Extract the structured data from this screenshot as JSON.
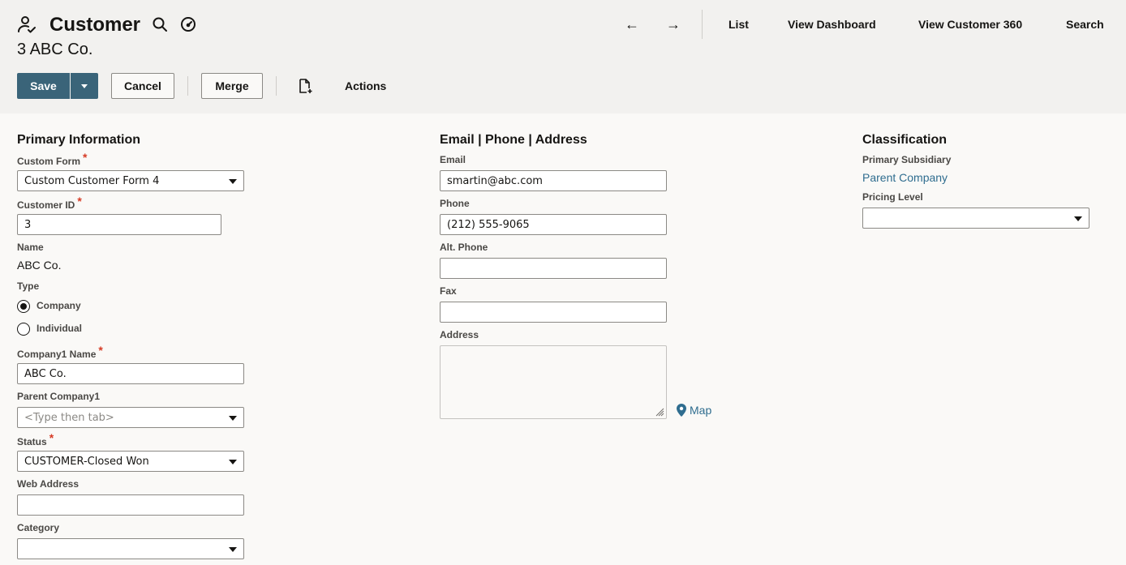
{
  "header": {
    "record_type": "Customer",
    "record_name": "3 ABC Co.",
    "nav": {
      "back_arrow": "←",
      "forward_arrow": "→",
      "list": "List",
      "view_dashboard": "View Dashboard",
      "view_customer_360": "View Customer 360",
      "search": "Search"
    },
    "icons": [
      "person-check-icon",
      "search-icon",
      "dashboard-icon"
    ]
  },
  "toolbar": {
    "save": "Save",
    "cancel": "Cancel",
    "merge": "Merge",
    "actions": "Actions"
  },
  "primary": {
    "title": "Primary Information",
    "custom_form_label": "Custom Form",
    "custom_form_value": "Custom Customer Form 4",
    "customer_id_label": "Customer ID",
    "customer_id_value": "3",
    "name_label": "Name",
    "name_value": "ABC Co.",
    "type_label": "Type",
    "type_options": [
      "Company",
      "Individual"
    ],
    "type_selected": "Company",
    "company_name_label": "Company1 Name",
    "company_name_value": "ABC Co.",
    "parent_company_label": "Parent Company1",
    "parent_company_placeholder": "<Type then tab>",
    "status_label": "Status",
    "status_value": "CUSTOMER-Closed Won",
    "web_address_label": "Web Address",
    "web_address_value": "",
    "category_label": "Category",
    "category_value": "",
    "required_mark": "*"
  },
  "contact": {
    "title": "Email | Phone | Address",
    "email_label": "Email",
    "email_value": "smartin@abc.com",
    "phone_label": "Phone",
    "phone_value": "(212) 555-9065",
    "alt_phone_label": "Alt. Phone",
    "alt_phone_value": "",
    "fax_label": "Fax",
    "fax_value": "",
    "address_label": "Address",
    "address_value": "",
    "map_link": "Map"
  },
  "classification": {
    "title": "Classification",
    "primary_subsidiary_label": "Primary Subsidiary",
    "primary_subsidiary_value": "Parent Company",
    "pricing_level_label": "Pricing Level",
    "pricing_level_value": ""
  },
  "colors": {
    "header_bg": "#f2f1ef",
    "body_bg": "#faf9f7",
    "primary_button": "#3a6479",
    "link": "#2f6d8f",
    "required": "#d63b25"
  }
}
